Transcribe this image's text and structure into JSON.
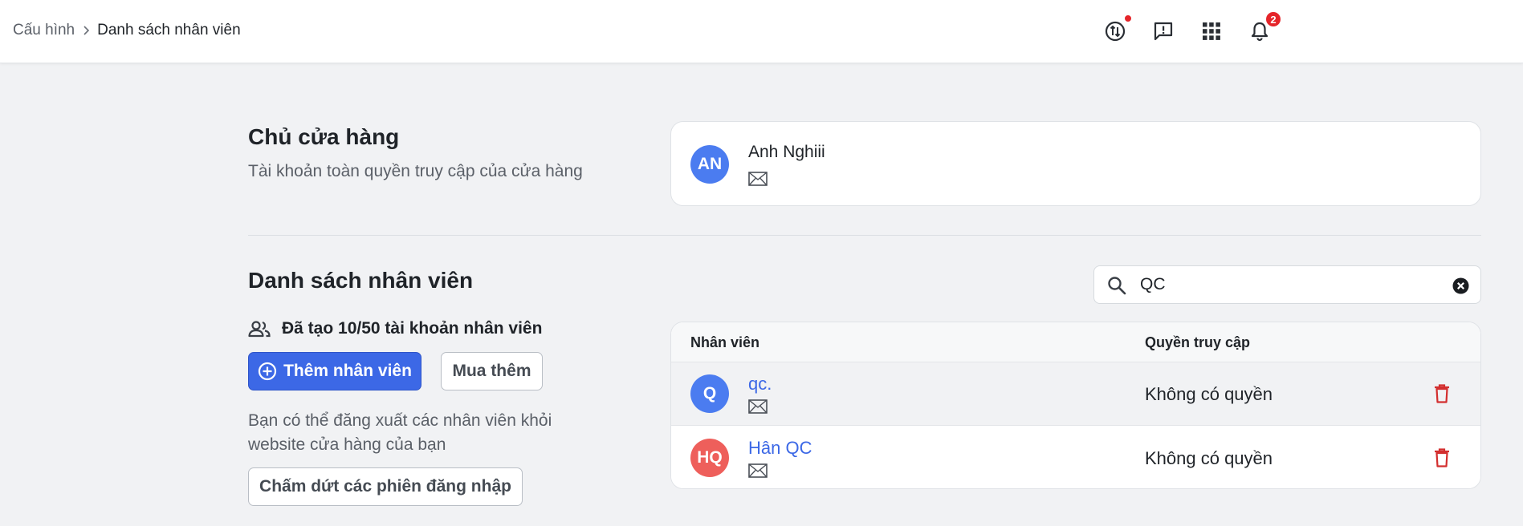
{
  "breadcrumb": {
    "parent": "Cấu hình",
    "current": "Danh sách nhân viên"
  },
  "topbar": {
    "icons": [
      "sync-icon",
      "feedback-icon",
      "apps-grid-icon",
      "bell-icon"
    ],
    "notification_count": "2",
    "colors": {
      "badge": "#e5252a"
    }
  },
  "owner_section": {
    "title": "Chủ cửa hàng",
    "description": "Tài khoản toàn quyền truy cập của cửa hàng",
    "owner": {
      "initials": "AN",
      "name": "Anh Nghiii"
    }
  },
  "staff_section": {
    "title": "Danh sách nhân viên",
    "count_text": "Đã tạo 10/50 tài khoản nhân viên",
    "add_button": "Thêm nhân viên",
    "buy_button": "Mua thêm",
    "logout_desc": "Bạn có thể đăng xuất các nhân viên khỏi website cửa hàng của bạn",
    "logout_button": "Chấm dứt các phiên đăng nhập"
  },
  "search": {
    "value": "QC"
  },
  "table": {
    "headers": {
      "employee": "Nhân viên",
      "access": "Quyền truy cập"
    },
    "rows": [
      {
        "initials": "Q",
        "name": "qc.",
        "access": "Không có quyền",
        "avatar_color": "#4b7cf0"
      },
      {
        "initials": "HQ",
        "name": "Hân QC",
        "access": "Không có quyền",
        "avatar_color": "#ee5f5b"
      }
    ]
  },
  "colors": {
    "primary": "#3c68e6",
    "danger": "#d32f2f",
    "background": "#f1f2f4"
  }
}
